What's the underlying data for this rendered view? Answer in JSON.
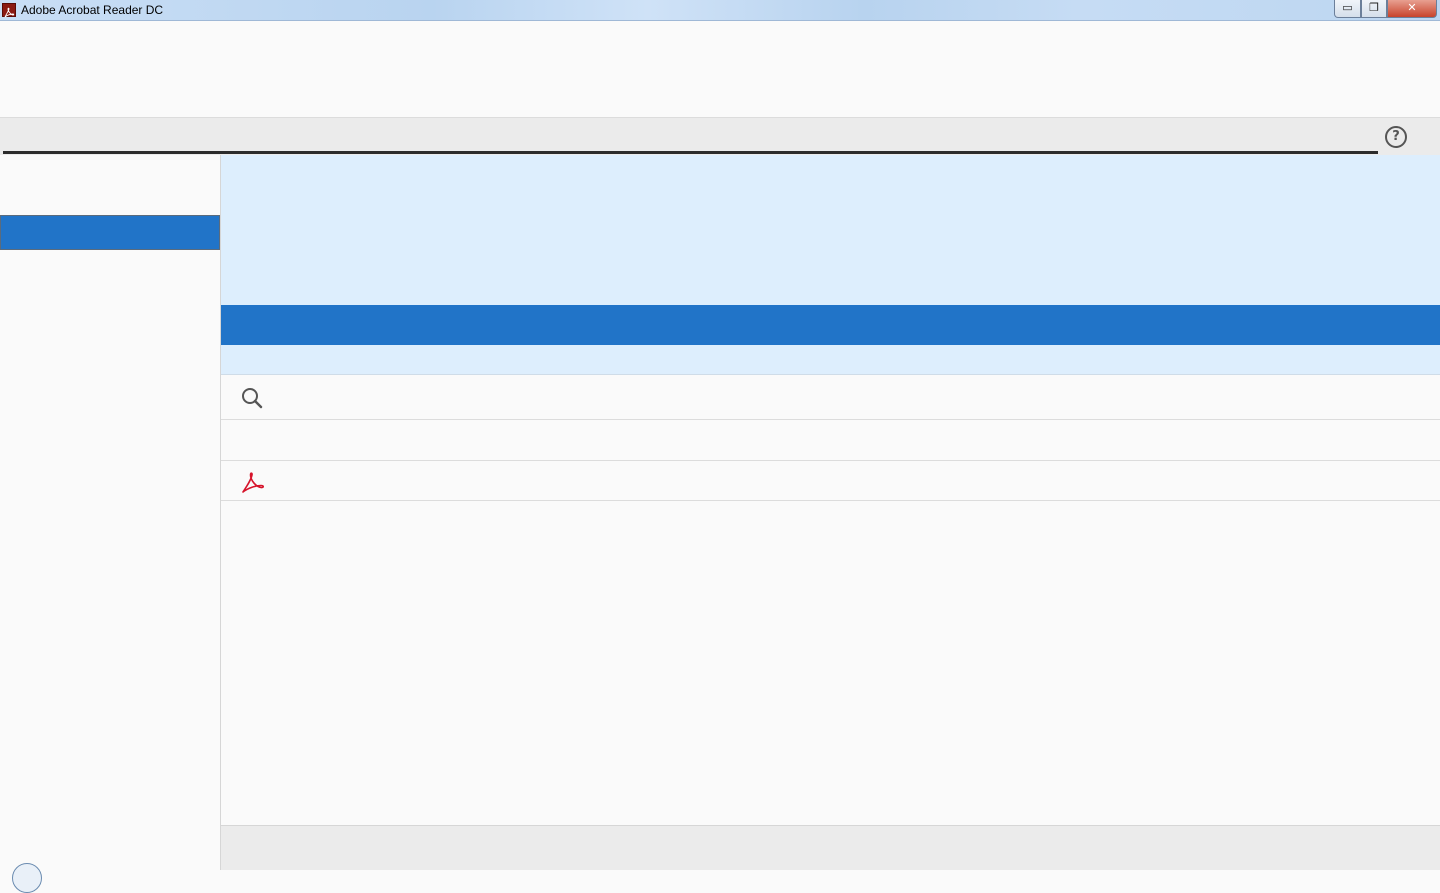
{
  "window": {
    "title": "Adobe Acrobat Reader DC",
    "controls": {
      "minimize": "▭",
      "maximize": "❐",
      "close": "✕"
    }
  },
  "toolbar": {
    "help_glyph": "?"
  },
  "icons": {
    "app": "acrobat-icon",
    "help": "help-icon",
    "search": "search-icon",
    "file": "pdf-icon"
  },
  "colors": {
    "accent": "#2174c8",
    "banner": "#ddeefd",
    "pdf_red": "#d6142b"
  }
}
